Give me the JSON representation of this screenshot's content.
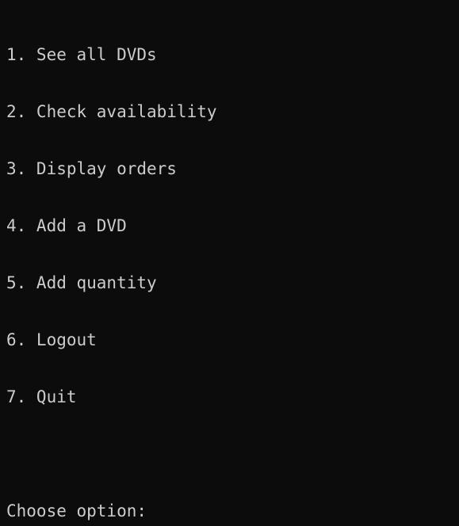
{
  "console": {
    "background": "#0c0c0c",
    "foreground": "#cccccc",
    "menu_items": [
      "1. See all DVDs",
      "2. Check availability",
      "3. Display orders",
      "4. Add a DVD",
      "5. Add quantity",
      "6. Logout",
      "7. Quit"
    ],
    "prompt": "Choose option:"
  }
}
